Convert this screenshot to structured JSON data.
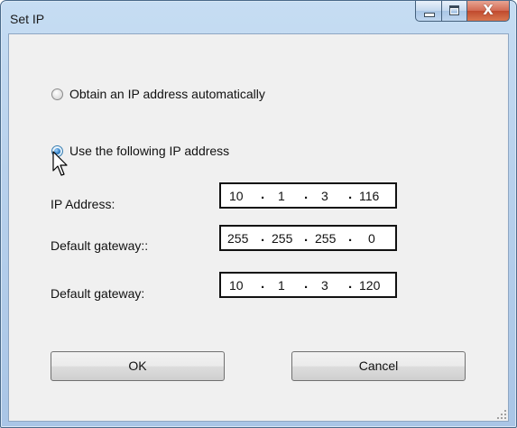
{
  "window": {
    "title": "Set IP",
    "controls": {
      "minimize_icon": "minimize-icon",
      "maximize_icon": "maximize-icon",
      "close_icon": "close-icon",
      "close_glyph": "X"
    }
  },
  "options": {
    "auto": {
      "label": "Obtain an IP address automatically",
      "checked": false
    },
    "manual": {
      "label": "Use the following IP address",
      "checked": true
    }
  },
  "fields": [
    {
      "label": "IP Address:",
      "octets": [
        "10",
        "1",
        "3",
        "116"
      ]
    },
    {
      "label": "Default gateway::",
      "octets": [
        "255",
        "255",
        "255",
        "0"
      ]
    },
    {
      "label": "Default gateway:",
      "octets": [
        "10",
        "1",
        "3",
        "120"
      ]
    }
  ],
  "buttons": {
    "ok": "OK",
    "cancel": "Cancel"
  },
  "colors": {
    "title_bar": "#b8d1ec",
    "close_button": "#c04a2e",
    "client_bg": "#f0f0f0",
    "radio_selected": "#1d6fb8"
  }
}
